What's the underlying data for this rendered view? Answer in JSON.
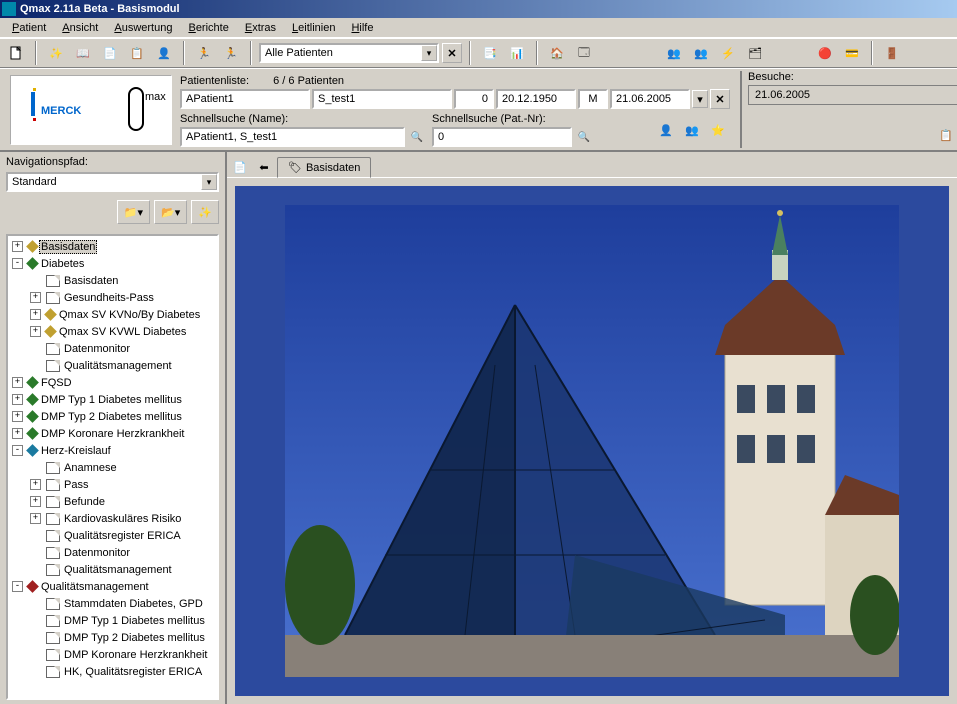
{
  "title": "Qmax 2.11a Beta - Basismodul",
  "menu": [
    "Patient",
    "Ansicht",
    "Auswertung",
    "Berichte",
    "Extras",
    "Leitlinien",
    "Hilfe"
  ],
  "toolbar_combo": "Alle Patienten",
  "patientlist_label": "Patientenliste:",
  "patientlist_count": "6 / 6  Patienten",
  "patient": {
    "name": "APatient1",
    "other": "S_test1",
    "num0": "0",
    "dob": "20.12.1950",
    "sex": "M",
    "date2": "21.06.2005"
  },
  "search_name_label": "Schnellsuche (Name):",
  "search_name_value": "APatient1, S_test1",
  "search_nr_label": "Schnellsuche (Pat.-Nr):",
  "search_nr_value": "0",
  "besuche_label": "Besuche:",
  "besuche_value": "21.06.2005",
  "nav_label": "Navigationspfad:",
  "nav_combo": "Standard",
  "tab_label": "Basisdaten",
  "tree": [
    {
      "lvl": 0,
      "pm": "+",
      "icon": "diamond",
      "color": "#c0a030",
      "label": "Basisdaten",
      "sel": true
    },
    {
      "lvl": 0,
      "pm": "-",
      "icon": "diamond",
      "color": "#2a7a2a",
      "label": "Diabetes"
    },
    {
      "lvl": 1,
      "pm": "",
      "icon": "page",
      "label": "Basisdaten"
    },
    {
      "lvl": 1,
      "pm": "+",
      "icon": "page",
      "label": "Gesundheits-Pass"
    },
    {
      "lvl": 1,
      "pm": "+",
      "icon": "diamond",
      "color": "#c0a030",
      "label": "Qmax SV KVNo/By Diabetes"
    },
    {
      "lvl": 1,
      "pm": "+",
      "icon": "diamond",
      "color": "#c0a030",
      "label": "Qmax SV KVWL Diabetes"
    },
    {
      "lvl": 1,
      "pm": "",
      "icon": "page",
      "label": "Datenmonitor"
    },
    {
      "lvl": 1,
      "pm": "",
      "icon": "page",
      "label": "Qualitätsmanagement"
    },
    {
      "lvl": 0,
      "pm": "+",
      "icon": "diamond",
      "color": "#2a7a2a",
      "label": "FQSD"
    },
    {
      "lvl": 0,
      "pm": "+",
      "icon": "diamond",
      "color": "#2a7a2a",
      "label": "DMP Typ 1 Diabetes mellitus"
    },
    {
      "lvl": 0,
      "pm": "+",
      "icon": "diamond",
      "color": "#2a7a2a",
      "label": "DMP Typ 2 Diabetes mellitus"
    },
    {
      "lvl": 0,
      "pm": "+",
      "icon": "diamond",
      "color": "#2a7a2a",
      "label": "DMP Koronare Herzkrankheit"
    },
    {
      "lvl": 0,
      "pm": "-",
      "icon": "diamond",
      "color": "#1a7aa0",
      "label": "Herz-Kreislauf"
    },
    {
      "lvl": 1,
      "pm": "",
      "icon": "page",
      "label": "Anamnese"
    },
    {
      "lvl": 1,
      "pm": "+",
      "icon": "page",
      "label": "Pass"
    },
    {
      "lvl": 1,
      "pm": "+",
      "icon": "page",
      "label": "Befunde"
    },
    {
      "lvl": 1,
      "pm": "+",
      "icon": "page",
      "label": "Kardiovaskuläres Risiko"
    },
    {
      "lvl": 1,
      "pm": "",
      "icon": "page",
      "label": "Qualitätsregister ERICA"
    },
    {
      "lvl": 1,
      "pm": "",
      "icon": "page",
      "label": "Datenmonitor"
    },
    {
      "lvl": 1,
      "pm": "",
      "icon": "page",
      "label": "Qualitätsmanagement"
    },
    {
      "lvl": 0,
      "pm": "-",
      "icon": "diamond",
      "color": "#a02020",
      "label": "Qualitätsmanagement"
    },
    {
      "lvl": 1,
      "pm": "",
      "icon": "page",
      "label": "Stammdaten Diabetes, GPD"
    },
    {
      "lvl": 1,
      "pm": "",
      "icon": "page",
      "label": "DMP Typ 1 Diabetes mellitus"
    },
    {
      "lvl": 1,
      "pm": "",
      "icon": "page",
      "label": "DMP Typ 2 Diabetes mellitus"
    },
    {
      "lvl": 1,
      "pm": "",
      "icon": "page",
      "label": "DMP Koronare Herzkrankheit"
    },
    {
      "lvl": 1,
      "pm": "",
      "icon": "page",
      "label": "HK, Qualitätsregister ERICA"
    }
  ],
  "logo_text1": "MERCK",
  "logo_text2": "max"
}
